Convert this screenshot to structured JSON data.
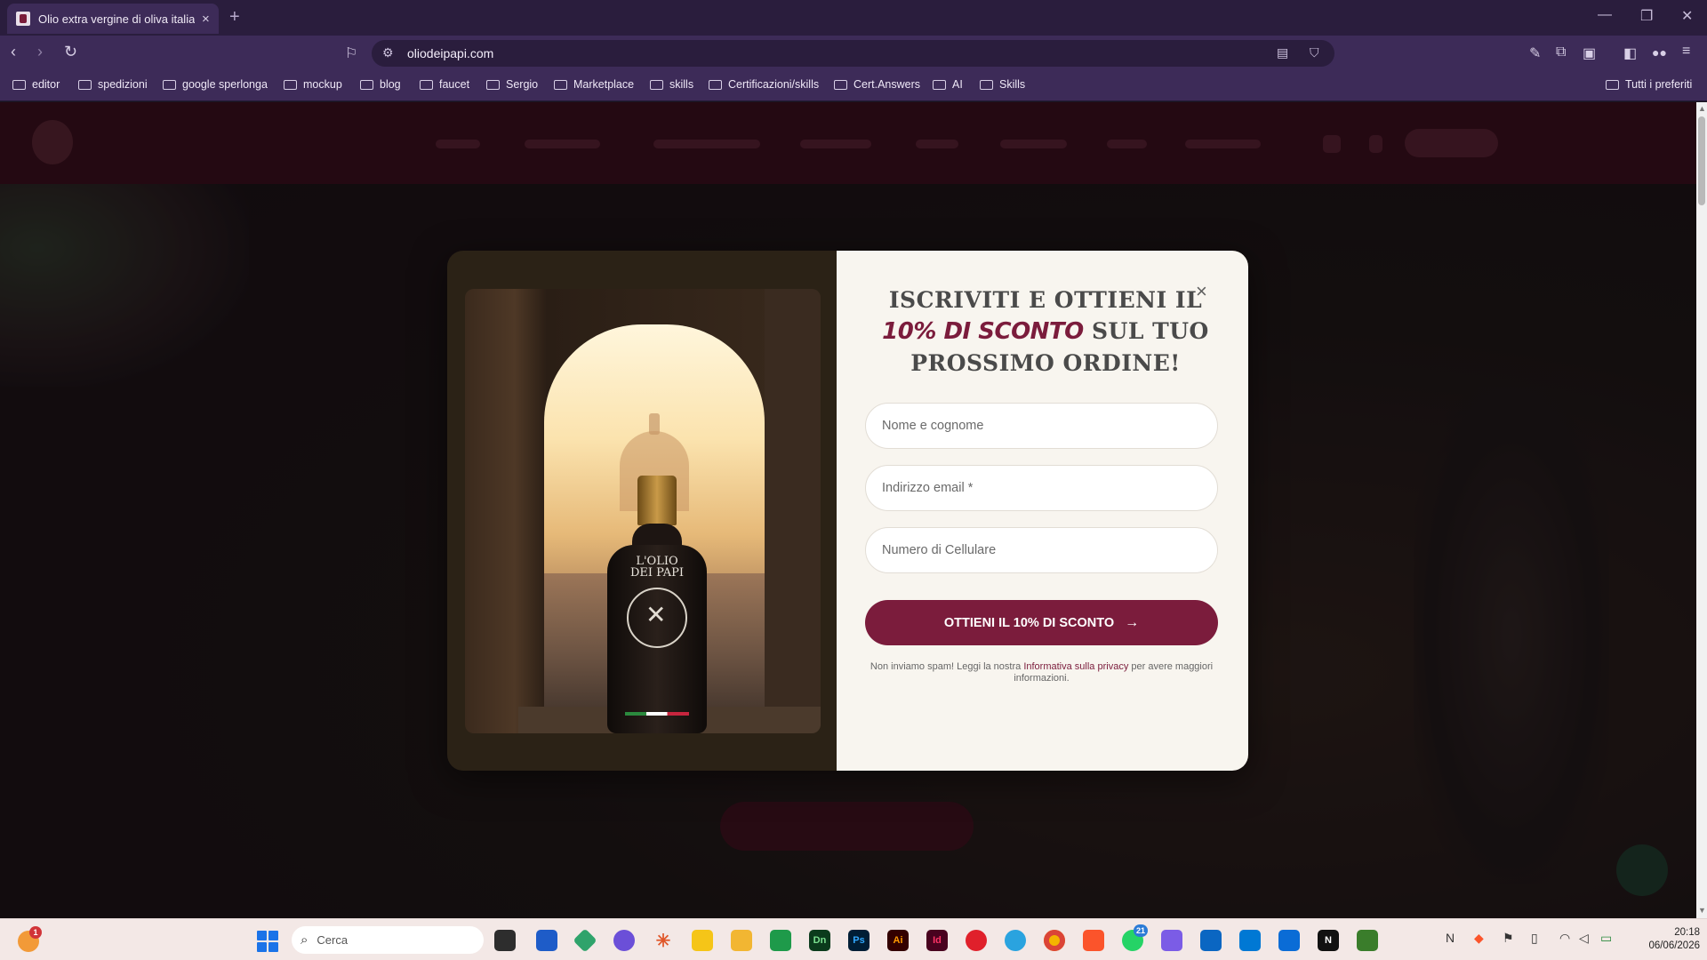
{
  "browser": {
    "tab_title": "Olio extra vergine di oliva italiano",
    "new_tab_symbol": "+",
    "url": "oliodeipapi.com",
    "bookmarks": [
      "editor",
      "spedizioni",
      "google sperlonga",
      "mockup",
      "blog",
      "faucet",
      "Sergio",
      "Marketplace",
      "skills",
      "Certificazioni/skills",
      "Cert.Answers",
      "AI",
      "Skills"
    ],
    "all_bookmarks_label": "Tutti i preferiti",
    "theme_color": "#3d2b58"
  },
  "popup": {
    "heading_line1": "ISCRIVITI E OTTIENI IL",
    "heading_accent": "10% DI SCONTO",
    "heading_line2_rest": " SUL TUO",
    "heading_line3": "PROSSIMO ORDINE!",
    "close_symbol": "×",
    "fields": {
      "name_placeholder": "Nome e cognome",
      "email_placeholder": "Indirizzo email *",
      "phone_placeholder": "Numero di Cellulare"
    },
    "cta_label": "OTTIENI IL 10% DI SCONTO",
    "cta_arrow": "→",
    "privacy_before": "Non inviamo spam! Leggi la nostra ",
    "privacy_link": "Informativa sulla privacy",
    "privacy_after": " per avere maggiori informazioni.",
    "bottle_label": "L'OLIO DEI PAPI",
    "accent_color": "#7b1c3c"
  },
  "taskbar": {
    "search_placeholder": "Cerca",
    "notification_badge": "1",
    "whatsapp_badge": "21",
    "time": "20:18",
    "date": "06/06/2026",
    "apps": [
      "Dn",
      "Ps",
      "Ai",
      "Id"
    ]
  }
}
